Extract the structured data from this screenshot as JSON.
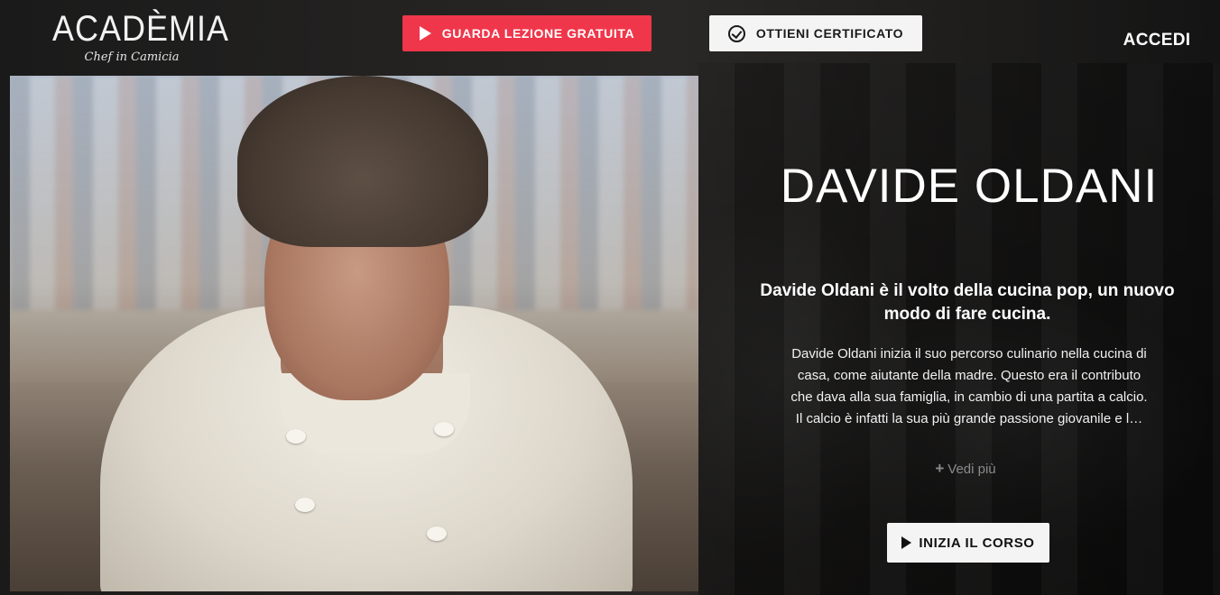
{
  "header": {
    "logo_main": "ACADÈMIA",
    "logo_sub": "Chef in Camicia",
    "free_lesson_label": "GUARDA LEZIONE GRATUITA",
    "certificate_label": "OTTIENI CERTIFICATO",
    "login_label": "ACCEDI"
  },
  "course": {
    "chef_name": "DAVIDE OLDANI",
    "tagline": "Davide Oldani è il volto della cucina pop, un nuovo modo di fare cucina.",
    "bio_lines": [
      "Davide Oldani inizia il suo percorso culinario nella cucina di",
      "casa, come aiutante della madre. Questo era il contributo",
      "che dava alla sua famiglia, in cambio di una partita a calcio.",
      "Il calcio è infatti la sua più grande passione giovanile e l…"
    ],
    "see_more_label": "Vedi più",
    "start_label": "INIZIA IL CORSO"
  },
  "colors": {
    "accent_red": "#f0364a",
    "button_light": "#f4f4f4"
  },
  "icons": [
    "play-icon",
    "check-circle-icon",
    "plus-icon"
  ]
}
